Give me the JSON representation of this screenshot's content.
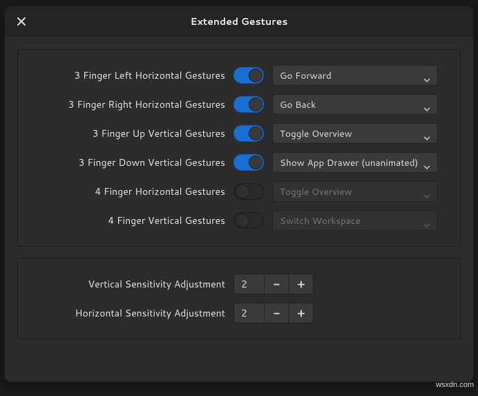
{
  "window": {
    "title": "Extended Gestures"
  },
  "gestures": [
    {
      "label": "3 Finger Left Horizontal Gestures",
      "enabled": true,
      "action": "Go Forward"
    },
    {
      "label": "3 Finger Right Horizontal Gestures",
      "enabled": true,
      "action": "Go Back"
    },
    {
      "label": "3 Finger Up Vertical Gestures",
      "enabled": true,
      "action": "Toggle Overview"
    },
    {
      "label": "3 Finger Down Vertical Gestures",
      "enabled": true,
      "action": "Show App Drawer (unanimated)"
    },
    {
      "label": "4 Finger Horizontal Gestures",
      "enabled": false,
      "action": "Toggle Overview"
    },
    {
      "label": "4 Finger Vertical Gestures",
      "enabled": false,
      "action": "Switch Workspace"
    }
  ],
  "sensitivity": {
    "vertical": {
      "label": "Vertical Sensitivity Adjustment",
      "value": 2
    },
    "horizontal": {
      "label": "Horizontal Sensitivity Adjustment",
      "value": 2
    }
  },
  "glyphs": {
    "minus": "−",
    "plus": "+"
  },
  "footer_url": "wsxdn.com"
}
